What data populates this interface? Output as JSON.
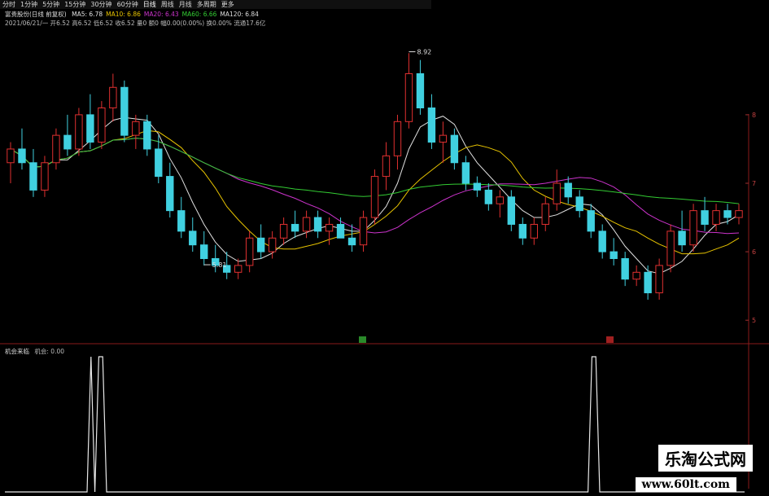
{
  "toolbar": {
    "items": [
      "分时",
      "1分钟",
      "5分钟",
      "15分钟",
      "30分钟",
      "60分钟",
      "日线",
      "周线",
      "月线",
      "多周期",
      "更多"
    ],
    "active": "日线"
  },
  "header": {
    "stock": "富贵股份(日线 前复权)",
    "ma": [
      {
        "label": "MA5",
        "value": "6.78",
        "color": "#e0e0e0"
      },
      {
        "label": "MA10",
        "value": "6.86",
        "color": "#e8c400"
      },
      {
        "label": "MA20",
        "value": "6.43",
        "color": "#cc33cc"
      },
      {
        "label": "MA60",
        "value": "6.66",
        "color": "#33cc33"
      },
      {
        "label": "MA120",
        "value": "6.84",
        "color": "#dddddd"
      }
    ],
    "quote": "2021/06/21/一 开6.52 高6.52 低6.52 收6.52 量0 额0 幅0.00(0.00%) 换0.00% 流通17.6亿"
  },
  "sub_chart": {
    "title": "机会来临",
    "value_label": "机会: 0.00"
  },
  "watermark": {
    "name": "乐淘公式网",
    "url": "www.60lt.com"
  },
  "chart_data": [
    {
      "type": "candlestick",
      "ylim": [
        4.8,
        9.2
      ],
      "y_ticks": [
        "7",
        "8",
        "6",
        "5"
      ],
      "annotations": [
        {
          "label": "8.92",
          "value": 8.92
        },
        {
          "label": "5.81",
          "value": 5.81
        }
      ],
      "series": [
        {
          "name": "MA5"
        },
        {
          "name": "MA10"
        },
        {
          "name": "MA20"
        },
        {
          "name": "MA60"
        }
      ],
      "candles": [
        [
          7.3,
          7.6,
          7.0,
          7.5
        ],
        [
          7.5,
          7.8,
          7.2,
          7.3
        ],
        [
          7.3,
          7.5,
          6.8,
          6.9
        ],
        [
          6.9,
          7.4,
          6.8,
          7.3
        ],
        [
          7.3,
          7.8,
          7.2,
          7.7
        ],
        [
          7.7,
          8.0,
          7.4,
          7.5
        ],
        [
          7.5,
          8.1,
          7.4,
          8.0
        ],
        [
          8.0,
          8.3,
          7.5,
          7.6
        ],
        [
          7.6,
          8.2,
          7.5,
          8.1
        ],
        [
          8.1,
          8.6,
          7.9,
          8.4
        ],
        [
          8.4,
          8.5,
          7.6,
          7.7
        ],
        [
          7.7,
          8.0,
          7.5,
          7.9
        ],
        [
          7.9,
          8.0,
          7.4,
          7.5
        ],
        [
          7.5,
          7.7,
          7.0,
          7.1
        ],
        [
          7.1,
          7.3,
          6.5,
          6.6
        ],
        [
          6.6,
          6.8,
          6.2,
          6.3
        ],
        [
          6.3,
          6.5,
          6.0,
          6.1
        ],
        [
          6.1,
          6.3,
          5.8,
          5.9
        ],
        [
          5.9,
          6.1,
          5.7,
          5.8
        ],
        [
          5.8,
          6.0,
          5.6,
          5.7
        ],
        [
          5.7,
          5.9,
          5.6,
          5.8
        ],
        [
          5.8,
          6.3,
          5.7,
          6.2
        ],
        [
          6.2,
          6.4,
          5.9,
          6.0
        ],
        [
          6.0,
          6.3,
          5.9,
          6.2
        ],
        [
          6.2,
          6.5,
          6.1,
          6.4
        ],
        [
          6.4,
          6.6,
          6.2,
          6.3
        ],
        [
          6.3,
          6.6,
          6.2,
          6.5
        ],
        [
          6.5,
          6.6,
          6.2,
          6.3
        ],
        [
          6.3,
          6.5,
          6.1,
          6.4
        ],
        [
          6.4,
          6.5,
          6.2,
          6.2
        ],
        [
          6.2,
          6.4,
          6.0,
          6.1
        ],
        [
          6.1,
          6.6,
          6.0,
          6.5
        ],
        [
          6.5,
          7.2,
          6.4,
          7.1
        ],
        [
          7.1,
          7.6,
          6.9,
          7.4
        ],
        [
          7.4,
          8.0,
          7.2,
          7.9
        ],
        [
          7.9,
          8.9,
          7.8,
          8.6
        ],
        [
          8.6,
          8.8,
          8.0,
          8.1
        ],
        [
          8.1,
          8.3,
          7.5,
          7.6
        ],
        [
          7.6,
          7.9,
          7.3,
          7.7
        ],
        [
          7.7,
          7.8,
          7.2,
          7.3
        ],
        [
          7.3,
          7.4,
          6.9,
          7.0
        ],
        [
          7.0,
          7.1,
          6.8,
          6.9
        ],
        [
          6.9,
          7.0,
          6.6,
          6.7
        ],
        [
          6.7,
          6.9,
          6.5,
          6.8
        ],
        [
          6.8,
          6.9,
          6.3,
          6.4
        ],
        [
          6.4,
          6.5,
          6.1,
          6.2
        ],
        [
          6.2,
          6.5,
          6.1,
          6.4
        ],
        [
          6.4,
          6.8,
          6.3,
          6.7
        ],
        [
          6.7,
          7.2,
          6.6,
          7.0
        ],
        [
          7.0,
          7.1,
          6.7,
          6.8
        ],
        [
          6.8,
          6.9,
          6.5,
          6.6
        ],
        [
          6.6,
          6.7,
          6.2,
          6.3
        ],
        [
          6.3,
          6.4,
          5.9,
          6.0
        ],
        [
          6.0,
          6.2,
          5.8,
          5.9
        ],
        [
          5.9,
          6.0,
          5.5,
          5.6
        ],
        [
          5.6,
          5.8,
          5.5,
          5.7
        ],
        [
          5.7,
          5.8,
          5.3,
          5.4
        ],
        [
          5.4,
          5.9,
          5.3,
          5.8
        ],
        [
          5.8,
          6.4,
          5.7,
          6.3
        ],
        [
          6.3,
          6.6,
          6.0,
          6.1
        ],
        [
          6.1,
          6.7,
          6.0,
          6.6
        ],
        [
          6.6,
          6.8,
          6.3,
          6.4
        ],
        [
          6.4,
          6.7,
          6.3,
          6.6
        ],
        [
          6.6,
          6.7,
          6.4,
          6.5
        ],
        [
          6.5,
          6.7,
          6.4,
          6.6
        ]
      ]
    },
    {
      "type": "line",
      "title": "机会来临",
      "ylim": [
        0,
        1
      ],
      "values": [
        0,
        0,
        0,
        0,
        0,
        0,
        0,
        0,
        0,
        0,
        0,
        0,
        0,
        0,
        0,
        0,
        0,
        0,
        0,
        0,
        0,
        0,
        1,
        0,
        1,
        1,
        0,
        0,
        0,
        0,
        0,
        0,
        0,
        0,
        0,
        0,
        0,
        0,
        0,
        0,
        0,
        0,
        0,
        0,
        0,
        0,
        0,
        0,
        0,
        0,
        0,
        0,
        0,
        0,
        0,
        0,
        0,
        0,
        0,
        0,
        0,
        0,
        0,
        0,
        0,
        0,
        0,
        0,
        0,
        0,
        0,
        0,
        0,
        0,
        0,
        0,
        0,
        0,
        0,
        0,
        0,
        0,
        0,
        0,
        0,
        0,
        0,
        0,
        0,
        0,
        0,
        0,
        0,
        0,
        0,
        0,
        0,
        0,
        0,
        0,
        0,
        0,
        0,
        0,
        0,
        0,
        0,
        0,
        0,
        0,
        0,
        0,
        0,
        0,
        0,
        0,
        0,
        0,
        0,
        0,
        0,
        0,
        0,
        0,
        0,
        0,
        0,
        0,
        0,
        0,
        0,
        0,
        0,
        0,
        0,
        0,
        0,
        0,
        0,
        0,
        0,
        0,
        0,
        0,
        0,
        0,
        0,
        0,
        0,
        0,
        1,
        1,
        0,
        0,
        0,
        0,
        0,
        0,
        0,
        0,
        0,
        0,
        0,
        0,
        0,
        0,
        0,
        0,
        0,
        0,
        0,
        0,
        0,
        0,
        0,
        0,
        0,
        0,
        0,
        0,
        0,
        0,
        0,
        0,
        0,
        0,
        0,
        0,
        0,
        0
      ]
    }
  ]
}
